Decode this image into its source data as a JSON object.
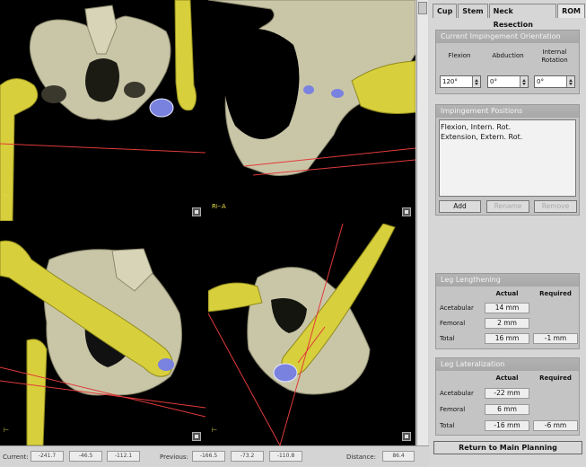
{
  "tabs": [
    {
      "label": "Cup",
      "active": false
    },
    {
      "label": "Stem",
      "active": false
    },
    {
      "label": "Neck Resection",
      "active": false
    },
    {
      "label": "ROM",
      "active": true
    }
  ],
  "orientation": {
    "title": "Current Impingement Orientation",
    "flexion_label": "Flexion",
    "abduction_label": "Abduction",
    "internal_rotation_label_1": "Internal",
    "internal_rotation_label_2": "Rotation",
    "flexion_value": "120°",
    "abduction_value": "0°",
    "internal_rotation_value": "0°"
  },
  "impingement": {
    "title": "Impingement Positions",
    "items": [
      "Flexion, Intern. Rot.",
      "Extension, Extern. Rot."
    ],
    "add_label": "Add",
    "rename_label": "Rename",
    "remove_label": "Remove"
  },
  "leg_lengthening": {
    "title": "Leg Lengthening",
    "col_actual": "Actual",
    "col_required": "Required",
    "rows": [
      {
        "label": "Acetabular",
        "actual": "14 mm",
        "required": ""
      },
      {
        "label": "Femoral",
        "actual": "2 mm",
        "required": ""
      },
      {
        "label": "Total",
        "actual": "16 mm",
        "required": "-1 mm"
      }
    ]
  },
  "leg_lateralization": {
    "title": "Leg Lateralization",
    "col_actual": "Actual",
    "col_required": "Required",
    "rows": [
      {
        "label": "Acetabular",
        "actual": "-22 mm",
        "required": ""
      },
      {
        "label": "Femoral",
        "actual": "6 mm",
        "required": ""
      },
      {
        "label": "Total",
        "actual": "-16 mm",
        "required": "-6 mm"
      }
    ]
  },
  "return_label": "Return to Main Planning",
  "status": {
    "current_label": "Current:",
    "current_values": [
      "-241.7",
      "-46.5",
      "-112.1"
    ],
    "previous_label": "Previous:",
    "previous_values": [
      "-166.5",
      "-73.2",
      "-110.8"
    ],
    "distance_label": "Distance:",
    "distance_value": "86.4"
  },
  "colors": {
    "bone": "#c9c6a8",
    "femur": "#d8cf3c",
    "cup": "#7a82e0",
    "plane_line": "#e23a3a",
    "viewport_bg": "#000000"
  }
}
